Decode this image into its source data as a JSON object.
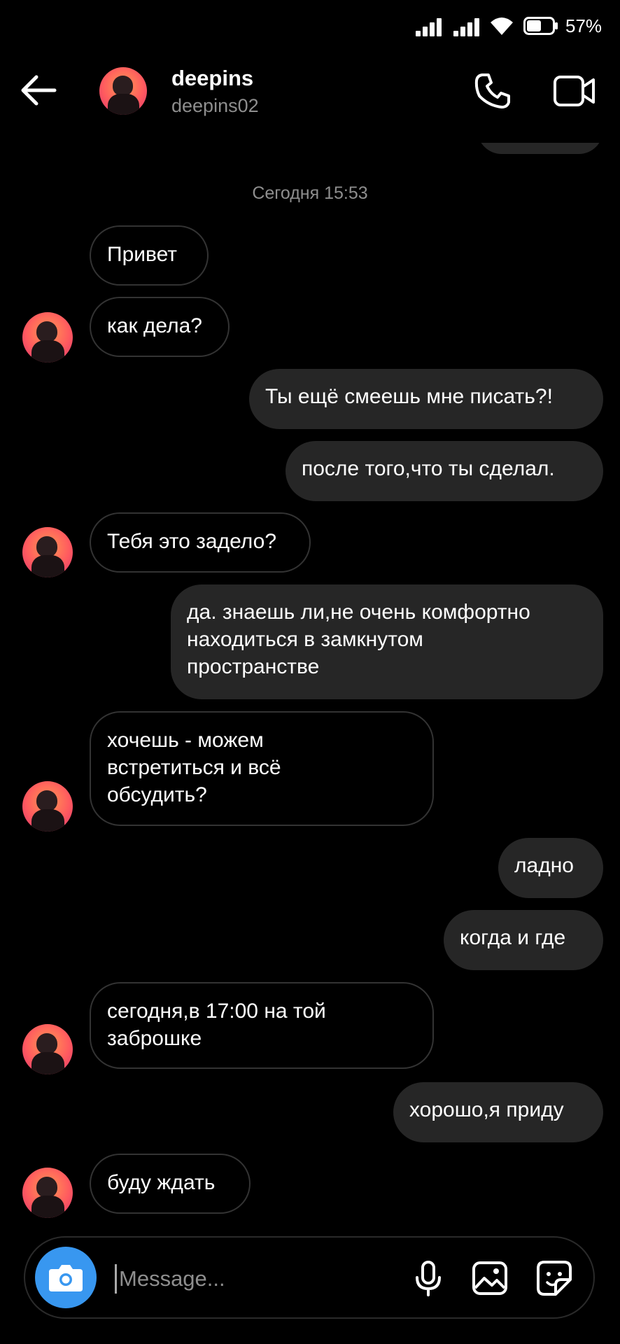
{
  "status_bar": {
    "battery_text": "57%"
  },
  "header": {
    "display_name": "deepins",
    "username": "deepins02"
  },
  "timestamp": "Сегодня 15:53",
  "messages": [
    {
      "text": "Привет",
      "direction": "in"
    },
    {
      "text": "как дела?",
      "direction": "in"
    },
    {
      "text": "Ты ещё смеешь мне писать?!",
      "direction": "out"
    },
    {
      "text": "после того,что ты сделал.",
      "direction": "out"
    },
    {
      "text": "Тебя это задело?",
      "direction": "in"
    },
    {
      "text": "да. знаешь ли,не очень комфортно\nнаходиться в замкнутом\nпространстве",
      "direction": "out"
    },
    {
      "text": "хочешь - можем\nвстретиться и всё\nобсудить?",
      "direction": "in"
    },
    {
      "text": "ладно",
      "direction": "out"
    },
    {
      "text": "когда и где",
      "direction": "out"
    },
    {
      "text": "сегодня,в 17:00 на той\nзаброшке",
      "direction": "in"
    },
    {
      "text": "хорошо,я приду",
      "direction": "out"
    },
    {
      "text": "буду ждать",
      "direction": "in"
    }
  ],
  "composer": {
    "placeholder": "Message..."
  },
  "icons": {
    "back": "arrow-left-icon",
    "call": "phone-icon",
    "video": "video-camera-icon",
    "camera": "camera-icon",
    "mic": "microphone-icon",
    "gallery": "image-icon",
    "sticker": "sticker-icon"
  },
  "colors": {
    "background": "#000000",
    "outgoing_bubble": "#262626",
    "incoming_border": "#333333",
    "secondary_text": "#8e8e8e",
    "camera_button": "#3897f0"
  }
}
